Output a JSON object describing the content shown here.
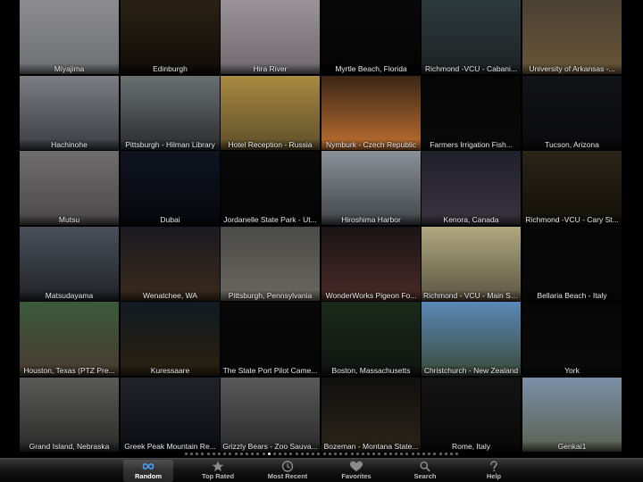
{
  "webcam_grid": {
    "tiles": [
      {
        "label": "Miyajima"
      },
      {
        "label": "Edinburgh"
      },
      {
        "label": "Hira River"
      },
      {
        "label": "Myrtle Beach, Florida"
      },
      {
        "label": "Richmond -VCU - Cabani..."
      },
      {
        "label": "University of Arkansas -..."
      },
      {
        "label": "Hachinohe"
      },
      {
        "label": "Pittsburgh - Hilman Library"
      },
      {
        "label": "Hotel Reception - Russia"
      },
      {
        "label": "Nymburk - Czech Republic"
      },
      {
        "label": "Farmers Irrigation Fish..."
      },
      {
        "label": "Tucson, Arizona"
      },
      {
        "label": "Mutsu"
      },
      {
        "label": "Dubai"
      },
      {
        "label": "Jordanelle State Park - Ut..."
      },
      {
        "label": "Hiroshima Harbor"
      },
      {
        "label": "Kenora, Canada"
      },
      {
        "label": "Richmond -VCU - Cary St..."
      },
      {
        "label": "Matsudayama"
      },
      {
        "label": "Wenatchee, WA"
      },
      {
        "label": "Pittsburgh, Pennsylvania"
      },
      {
        "label": "WonderWorks Pigeon Fo..."
      },
      {
        "label": "Richmond - VCU - Main St..."
      },
      {
        "label": "Bellaria Beach - Italy"
      },
      {
        "label": "Houston, Texas (PTZ Pre..."
      },
      {
        "label": "Kuressaare"
      },
      {
        "label": "The State Port Pilot Came..."
      },
      {
        "label": "Boston, Massachusetts"
      },
      {
        "label": "Christchurch - New Zealand"
      },
      {
        "label": "York"
      },
      {
        "label": "Grand Island, Nebraska"
      },
      {
        "label": "Greek Peak Mountain Re..."
      },
      {
        "label": "Grizzly Bears - Zoo Sauva..."
      },
      {
        "label": "Bozeman - Montana State..."
      },
      {
        "label": "Rome, Italy"
      },
      {
        "label": "Genkai1"
      }
    ],
    "thumb_colors": [
      [
        "#8c8c8e",
        "#6d6e72"
      ],
      [
        "#2a2114",
        "#0f0b06"
      ],
      [
        "#9a9398",
        "#6f6a6e"
      ],
      [
        "#080808",
        "#040404"
      ],
      [
        "#2d3a3c",
        "#1d2224"
      ],
      [
        "#4a4032",
        "#6a5638"
      ],
      [
        "#7a7e84",
        "#3a3c40"
      ],
      [
        "#6a7072",
        "#2a2c2e"
      ],
      [
        "#a88a40",
        "#5e4e2a"
      ],
      [
        "#3a2616",
        "#c07030"
      ],
      [
        "#050505",
        "#0a0a0a"
      ],
      [
        "#121316",
        "#0a0a0c"
      ],
      [
        "#6e6c6c",
        "#4a4848"
      ],
      [
        "#101420",
        "#06080e"
      ],
      [
        "#080808",
        "#040404"
      ],
      [
        "#8a9098",
        "#404448"
      ],
      [
        "#20202a",
        "#3a3440"
      ],
      [
        "#2a2418",
        "#121008"
      ],
      [
        "#4a505a",
        "#202226"
      ],
      [
        "#1a1a22",
        "#3a2a1a"
      ],
      [
        "#4a4a48",
        "#6a6860"
      ],
      [
        "#1a1416",
        "#4a2a28"
      ],
      [
        "#b0a880",
        "#5a5440"
      ],
      [
        "#060606",
        "#080808"
      ],
      [
        "#3a5a3a",
        "#4a3a30"
      ],
      [
        "#121a22",
        "#2a2010"
      ],
      [
        "#080808",
        "#040404"
      ],
      [
        "#1a2a1a",
        "#101410"
      ],
      [
        "#5a88b8",
        "#3a4a3a"
      ],
      [
        "#060606",
        "#0a0a0a"
      ],
      [
        "#5a5a58",
        "#2a2a2a"
      ],
      [
        "#202428",
        "#0a0c10"
      ],
      [
        "#5a5a5a",
        "#2a2a2a"
      ],
      [
        "#101010",
        "#2a2418"
      ],
      [
        "#141414",
        "#080808"
      ],
      [
        "#7a90a8",
        "#5a6050"
      ]
    ]
  },
  "page_indicator": {
    "total": 50,
    "current": 15
  },
  "tab_bar": {
    "tabs": [
      {
        "label": "Random",
        "icon": "infinity-icon",
        "active": true
      },
      {
        "label": "Top Rated",
        "icon": "star-icon",
        "active": false
      },
      {
        "label": "Most Recent",
        "icon": "clock-icon",
        "active": false
      },
      {
        "label": "Favorites",
        "icon": "heart-icon",
        "active": false
      },
      {
        "label": "Search",
        "icon": "search-icon",
        "active": false
      },
      {
        "label": "Help",
        "icon": "question-icon",
        "active": false
      }
    ]
  }
}
